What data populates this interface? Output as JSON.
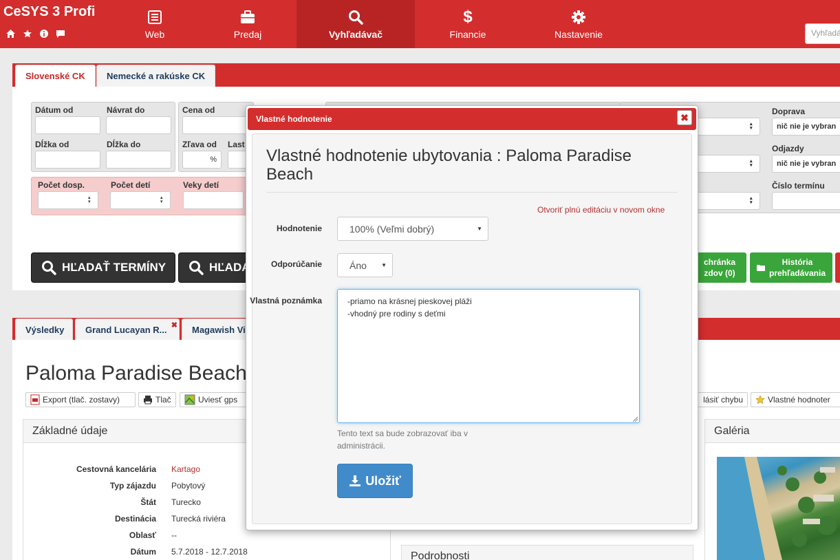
{
  "app": {
    "brand": "CeSYS 3 Profi",
    "nav": [
      {
        "label": "Web",
        "icon": "list-icon"
      },
      {
        "label": "Predaj",
        "icon": "briefcase-icon"
      },
      {
        "label": "Vyhľadávač",
        "icon": "search-icon"
      },
      {
        "label": "Financie",
        "icon": "dollar-icon"
      },
      {
        "label": "Nastavenie",
        "icon": "gear-icon"
      }
    ],
    "search_placeholder": "Vyhľadáv"
  },
  "search_tabs": [
    "Slovenské CK",
    "Nemecké a rakúske CK"
  ],
  "search_form": {
    "datum_od": "Dátum od",
    "navrat_do": "Návrat do",
    "dlzka_od": "Dĺžka od",
    "dlzka_do": "Dĺžka do",
    "cena_od": "Cena od",
    "zlava_od": "Zľava od",
    "zlava_unit": "%",
    "last_label": "Last",
    "pocet_dosp": "Počet dosp.",
    "pocet_deti": "Počet detí",
    "veky_deti": "Veky detí",
    "select_partial_e": "e",
    "doprava": "Doprava",
    "doprava_value": "nič nie je vybran",
    "odjazdy": "Odjazdy",
    "odjazdy_value": "nič nie je vybran",
    "cislo_terminu": "Číslo termínu",
    "btn_hladat_terminy": "HĽADAŤ TERMÍNY",
    "btn_hladat_2": "HĽADA",
    "btn_schranka": "chránka\nzdov (0)",
    "btn_historia": "História\nprehľadávania"
  },
  "result_tabs": [
    "Výsledky",
    "Grand Lucayan R...",
    "Magawish Vi"
  ],
  "hotel": {
    "title": "Paloma Paradise Beach",
    "toolbar": [
      "Export (tlač. zostavy)",
      "Tlač",
      "Uviesť gps",
      "lásiť chybu",
      "Vlastné hodnoter"
    ]
  },
  "basic_info": {
    "heading": "Základné údaje",
    "rows": [
      {
        "k": "Cestovná kancelária",
        "v": "Kartago"
      },
      {
        "k": "Typ zájazdu",
        "v": "Pobytový"
      },
      {
        "k": "Štát",
        "v": "Turecko"
      },
      {
        "k": "Destinácia",
        "v": "Turecká riviéra"
      },
      {
        "k": "Oblasť",
        "v": "--"
      },
      {
        "k": "Dátum",
        "v": "5.7.2018 - 12.7.2018"
      }
    ]
  },
  "podrobnosti": "Podrobnosti",
  "galeria": "Galéria",
  "modal": {
    "header": "Vlastné hodnotenie",
    "title": "Vlastné hodnotenie ubytovania : Paloma Paradise Beach",
    "open_link": "Otvoriť plnú editáciu v novom okne",
    "rating_label": "Hodnotenie",
    "rating_value": "100% (Veľmi dobrý)",
    "recommend_label": "Odporúčanie",
    "recommend_value": "Áno",
    "note_label": "Vlastná poznámka",
    "note_value": "-priamo na krásnej pieskovej pláži\n-vhodný pre rodiny s deťmi",
    "help_text": "Tento text sa bude zobrazovať iba v administrácii.",
    "save_label": "Uložiť"
  }
}
